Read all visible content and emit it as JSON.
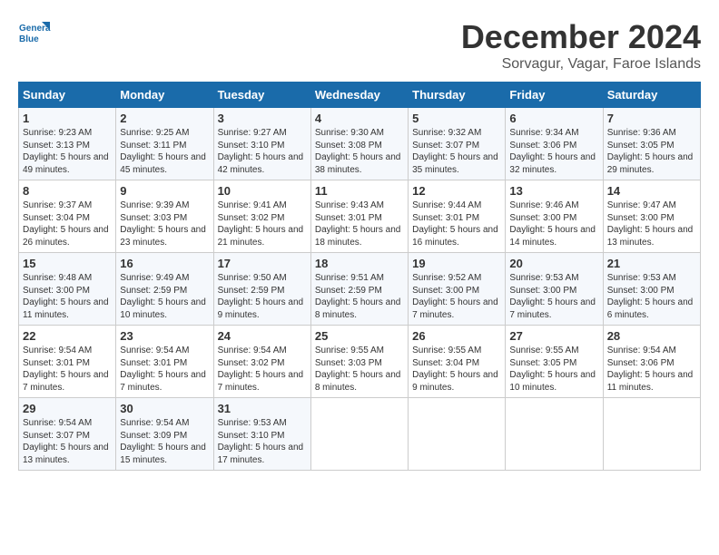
{
  "logo": {
    "line1": "General",
    "line2": "Blue"
  },
  "title": "December 2024",
  "subtitle": "Sorvagur, Vagar, Faroe Islands",
  "days_of_week": [
    "Sunday",
    "Monday",
    "Tuesday",
    "Wednesday",
    "Thursday",
    "Friday",
    "Saturday"
  ],
  "weeks": [
    [
      {
        "day": 1,
        "sunrise": "9:23 AM",
        "sunset": "3:13 PM",
        "daylight": "5 hours and 49 minutes."
      },
      {
        "day": 2,
        "sunrise": "9:25 AM",
        "sunset": "3:11 PM",
        "daylight": "5 hours and 45 minutes."
      },
      {
        "day": 3,
        "sunrise": "9:27 AM",
        "sunset": "3:10 PM",
        "daylight": "5 hours and 42 minutes."
      },
      {
        "day": 4,
        "sunrise": "9:30 AM",
        "sunset": "3:08 PM",
        "daylight": "5 hours and 38 minutes."
      },
      {
        "day": 5,
        "sunrise": "9:32 AM",
        "sunset": "3:07 PM",
        "daylight": "5 hours and 35 minutes."
      },
      {
        "day": 6,
        "sunrise": "9:34 AM",
        "sunset": "3:06 PM",
        "daylight": "5 hours and 32 minutes."
      },
      {
        "day": 7,
        "sunrise": "9:36 AM",
        "sunset": "3:05 PM",
        "daylight": "5 hours and 29 minutes."
      }
    ],
    [
      {
        "day": 8,
        "sunrise": "9:37 AM",
        "sunset": "3:04 PM",
        "daylight": "5 hours and 26 minutes."
      },
      {
        "day": 9,
        "sunrise": "9:39 AM",
        "sunset": "3:03 PM",
        "daylight": "5 hours and 23 minutes."
      },
      {
        "day": 10,
        "sunrise": "9:41 AM",
        "sunset": "3:02 PM",
        "daylight": "5 hours and 21 minutes."
      },
      {
        "day": 11,
        "sunrise": "9:43 AM",
        "sunset": "3:01 PM",
        "daylight": "5 hours and 18 minutes."
      },
      {
        "day": 12,
        "sunrise": "9:44 AM",
        "sunset": "3:01 PM",
        "daylight": "5 hours and 16 minutes."
      },
      {
        "day": 13,
        "sunrise": "9:46 AM",
        "sunset": "3:00 PM",
        "daylight": "5 hours and 14 minutes."
      },
      {
        "day": 14,
        "sunrise": "9:47 AM",
        "sunset": "3:00 PM",
        "daylight": "5 hours and 13 minutes."
      }
    ],
    [
      {
        "day": 15,
        "sunrise": "9:48 AM",
        "sunset": "3:00 PM",
        "daylight": "5 hours and 11 minutes."
      },
      {
        "day": 16,
        "sunrise": "9:49 AM",
        "sunset": "2:59 PM",
        "daylight": "5 hours and 10 minutes."
      },
      {
        "day": 17,
        "sunrise": "9:50 AM",
        "sunset": "2:59 PM",
        "daylight": "5 hours and 9 minutes."
      },
      {
        "day": 18,
        "sunrise": "9:51 AM",
        "sunset": "2:59 PM",
        "daylight": "5 hours and 8 minutes."
      },
      {
        "day": 19,
        "sunrise": "9:52 AM",
        "sunset": "3:00 PM",
        "daylight": "5 hours and 7 minutes."
      },
      {
        "day": 20,
        "sunrise": "9:53 AM",
        "sunset": "3:00 PM",
        "daylight": "5 hours and 7 minutes."
      },
      {
        "day": 21,
        "sunrise": "9:53 AM",
        "sunset": "3:00 PM",
        "daylight": "5 hours and 6 minutes."
      }
    ],
    [
      {
        "day": 22,
        "sunrise": "9:54 AM",
        "sunset": "3:01 PM",
        "daylight": "5 hours and 7 minutes."
      },
      {
        "day": 23,
        "sunrise": "9:54 AM",
        "sunset": "3:01 PM",
        "daylight": "5 hours and 7 minutes."
      },
      {
        "day": 24,
        "sunrise": "9:54 AM",
        "sunset": "3:02 PM",
        "daylight": "5 hours and 7 minutes."
      },
      {
        "day": 25,
        "sunrise": "9:55 AM",
        "sunset": "3:03 PM",
        "daylight": "5 hours and 8 minutes."
      },
      {
        "day": 26,
        "sunrise": "9:55 AM",
        "sunset": "3:04 PM",
        "daylight": "5 hours and 9 minutes."
      },
      {
        "day": 27,
        "sunrise": "9:55 AM",
        "sunset": "3:05 PM",
        "daylight": "5 hours and 10 minutes."
      },
      {
        "day": 28,
        "sunrise": "9:54 AM",
        "sunset": "3:06 PM",
        "daylight": "5 hours and 11 minutes."
      }
    ],
    [
      {
        "day": 29,
        "sunrise": "9:54 AM",
        "sunset": "3:07 PM",
        "daylight": "5 hours and 13 minutes."
      },
      {
        "day": 30,
        "sunrise": "9:54 AM",
        "sunset": "3:09 PM",
        "daylight": "5 hours and 15 minutes."
      },
      {
        "day": 31,
        "sunrise": "9:53 AM",
        "sunset": "3:10 PM",
        "daylight": "5 hours and 17 minutes."
      },
      null,
      null,
      null,
      null
    ]
  ]
}
